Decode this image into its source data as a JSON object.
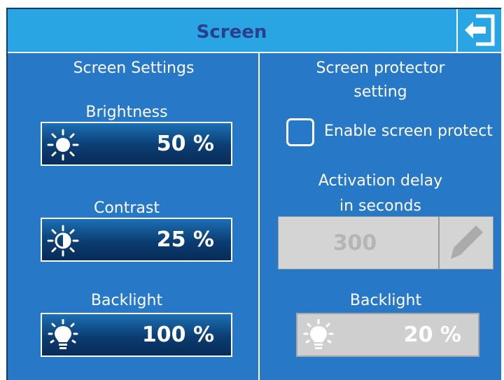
{
  "header": {
    "title": "Screen",
    "exit_icon": "exit-icon"
  },
  "left": {
    "heading": "Screen Settings",
    "brightness": {
      "label": "Brightness",
      "value": "50 %",
      "icon": "sun-icon"
    },
    "contrast": {
      "label": "Contrast",
      "value": "25 %",
      "icon": "contrast-icon"
    },
    "backlight": {
      "label": "Backlight",
      "value": "100 %",
      "icon": "bulb-icon"
    }
  },
  "right": {
    "heading_line1": "Screen protector",
    "heading_line2": "setting",
    "enable_label": "Enable screen protect",
    "enable_checked": false,
    "delay_line1": "Activation delay",
    "delay_line2": "in seconds",
    "delay_value": "300",
    "edit_icon": "pencil-icon",
    "backlight": {
      "label": "Backlight",
      "value": "20 %",
      "icon": "bulb-icon"
    }
  },
  "colors": {
    "background": "#2878c8",
    "titlebar": "#29a5e3",
    "title_text": "#2a3f8e",
    "disabled": "#cfcfcf"
  }
}
